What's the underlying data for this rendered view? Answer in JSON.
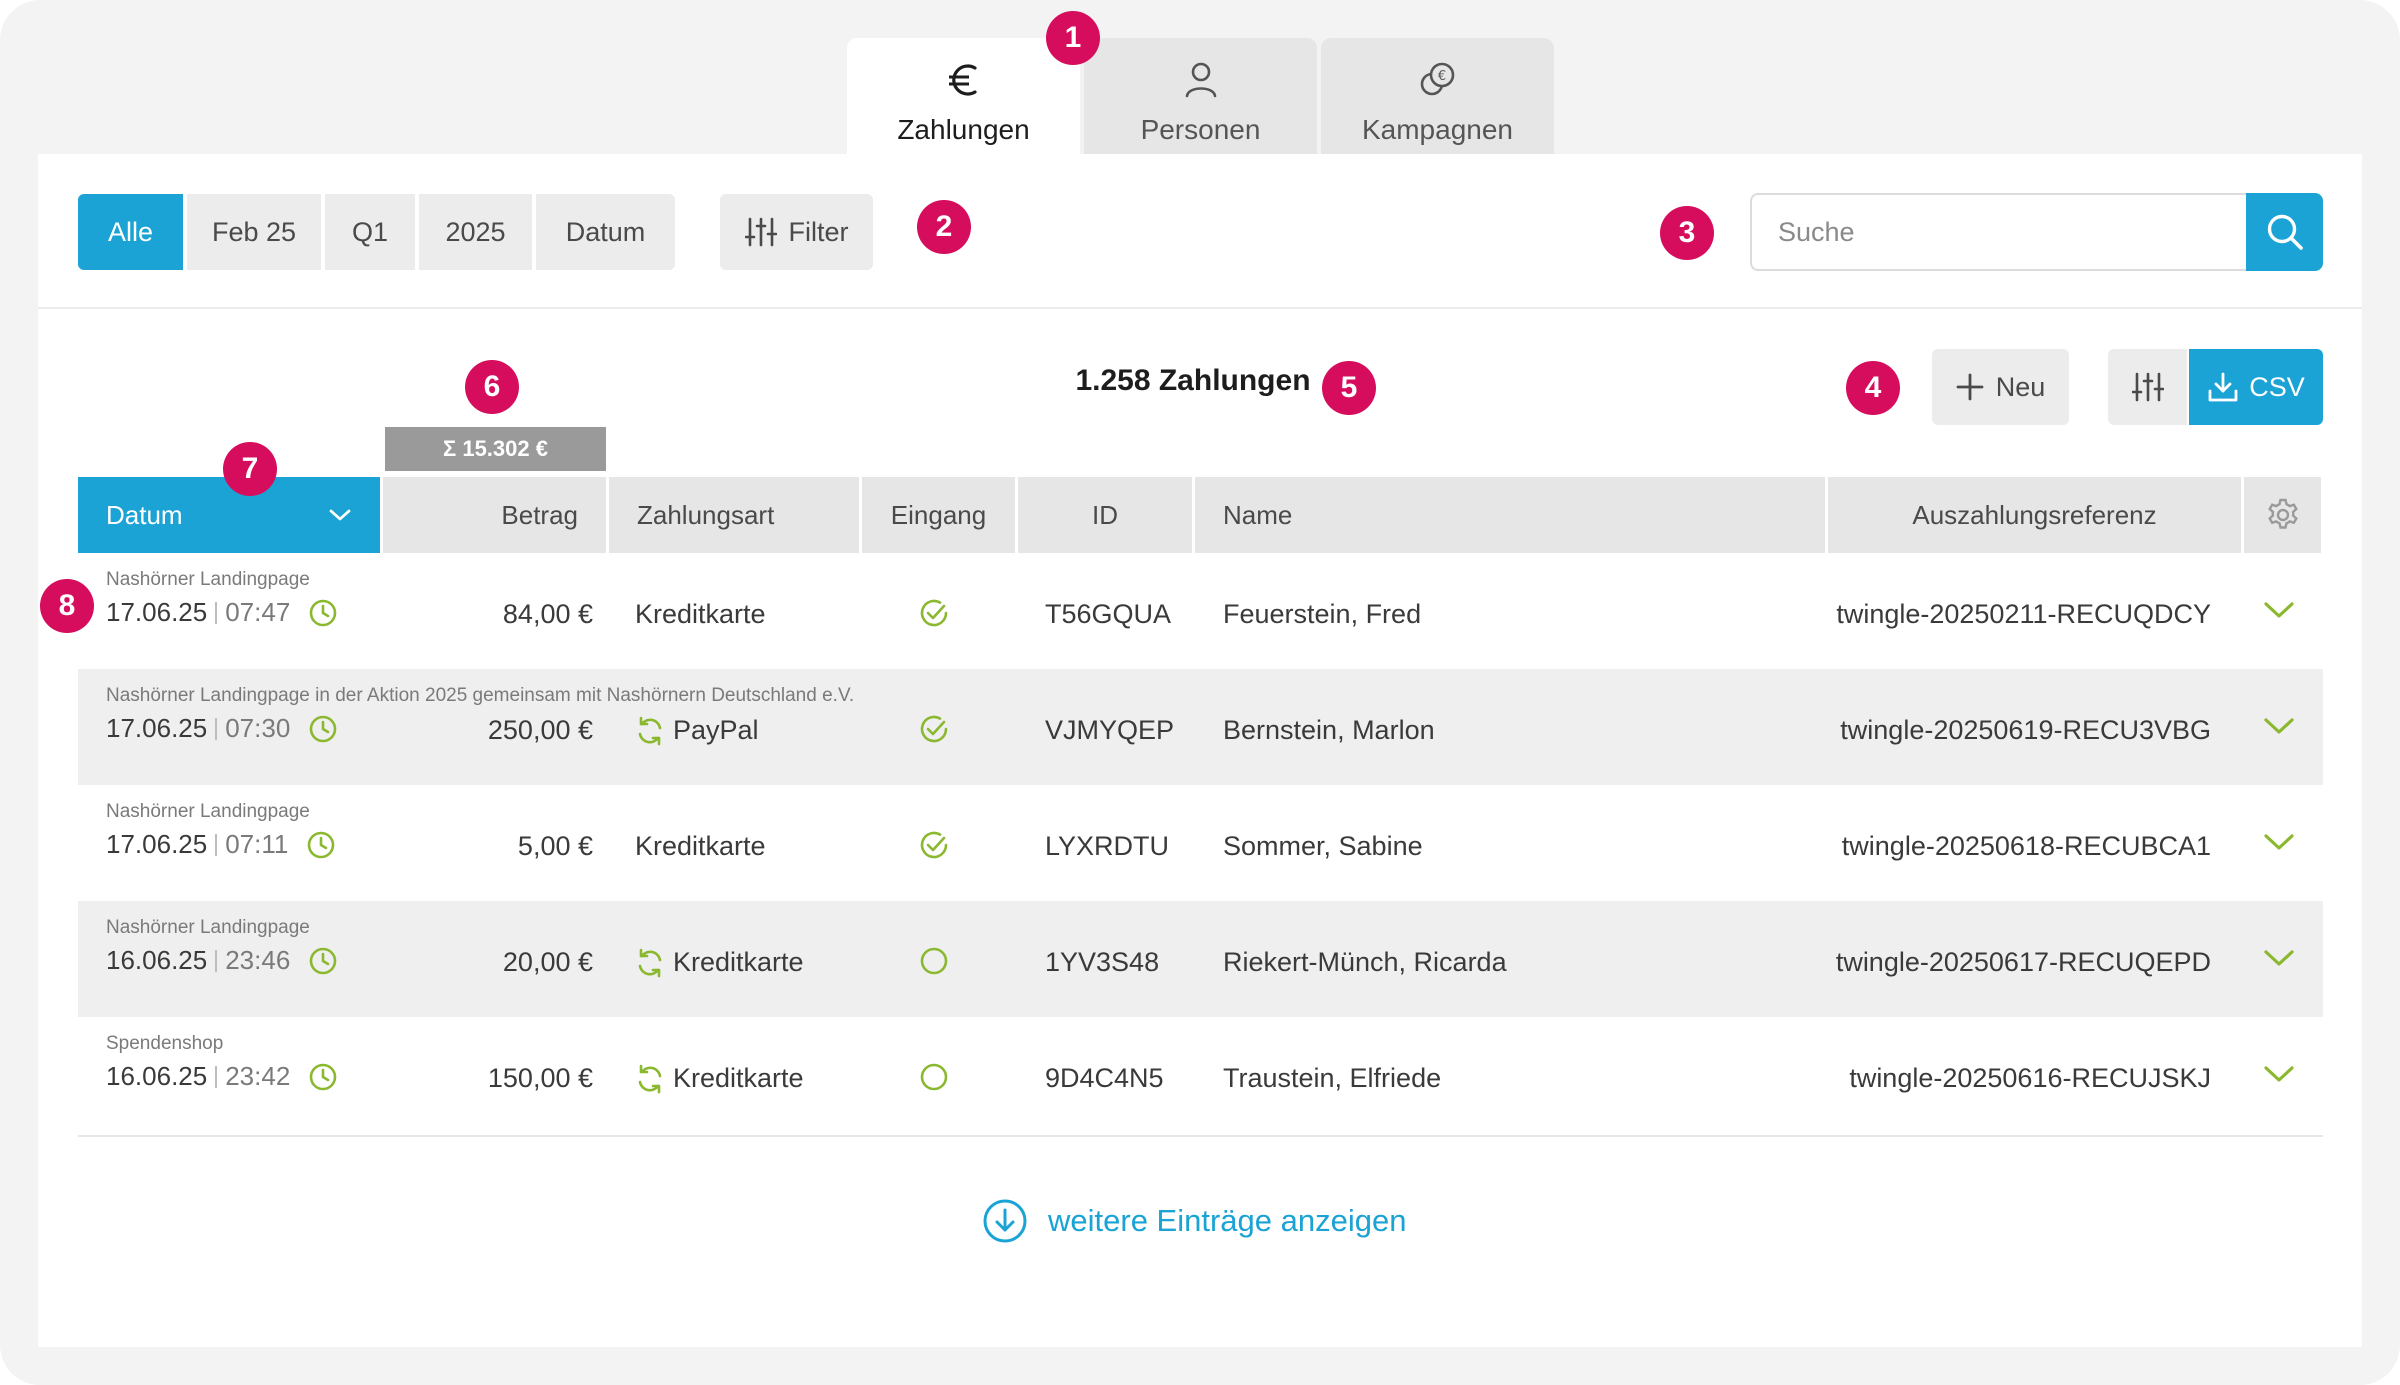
{
  "tabs": [
    {
      "label": "Zahlungen",
      "icon": "euro-icon",
      "active": true
    },
    {
      "label": "Personen",
      "icon": "person-icon",
      "active": false
    },
    {
      "label": "Kampagnen",
      "icon": "campaign-coins-icon",
      "active": false
    }
  ],
  "badges": [
    "1",
    "2",
    "3",
    "4",
    "5",
    "6",
    "7",
    "8"
  ],
  "periods": [
    {
      "label": "Alle",
      "active": true
    },
    {
      "label": "Feb 25",
      "active": false
    },
    {
      "label": "Q1",
      "active": false
    },
    {
      "label": "2025",
      "active": false
    },
    {
      "label": "Datum",
      "active": false
    }
  ],
  "filter": {
    "label": "Filter",
    "icon": "sliders-icon"
  },
  "search": {
    "placeholder": "Suche",
    "value": "",
    "icon": "search-icon"
  },
  "summary": {
    "count": "1.258 Zahlungen",
    "sum": "Σ 15.302 €"
  },
  "actions": {
    "new_label": "Neu",
    "csv_label": "CSV"
  },
  "table": {
    "columns": [
      "Datum",
      "Betrag",
      "Zahlungsart",
      "Eingang",
      "ID",
      "Name",
      "Auszahlungsreferenz"
    ],
    "rows": [
      {
        "source": "Nashörner Landingpage",
        "date": "17.06.25",
        "time": "07:47",
        "amount": "84,00 €",
        "method": "Kreditkarte",
        "recurring": false,
        "received": true,
        "id": "T56GQUA",
        "name": "Feuerstein, Fred",
        "ref": "twingle-20250211-RECUQDCY"
      },
      {
        "source": "Nashörner Landingpage in der Aktion 2025 gemeinsam mit Nashörnern Deutschland e.V.",
        "date": "17.06.25",
        "time": "07:30",
        "amount": "250,00 €",
        "method": "PayPal",
        "recurring": true,
        "received": true,
        "id": "VJMYQEP",
        "name": "Bernstein, Marlon",
        "ref": "twingle-20250619-RECU3VBG"
      },
      {
        "source": "Nashörner Landingpage",
        "date": "17.06.25",
        "time": "07:11",
        "amount": "5,00 €",
        "method": "Kreditkarte",
        "recurring": false,
        "received": true,
        "id": "LYXRDTU",
        "name": "Sommer, Sabine",
        "ref": "twingle-20250618-RECUBCA1"
      },
      {
        "source": "Nashörner Landingpage",
        "date": "16.06.25",
        "time": "23:46",
        "amount": "20,00 €",
        "method": "Kreditkarte",
        "recurring": true,
        "received": false,
        "id": "1YV3S48",
        "name": "Riekert-Münch, Ricarda",
        "ref": "twingle-20250617-RECUQEPD"
      },
      {
        "source": "Spendenshop",
        "date": "16.06.25",
        "time": "23:42",
        "amount": "150,00 €",
        "method": "Kreditkarte",
        "recurring": true,
        "received": false,
        "id": "9D4C4N5",
        "name": "Traustein, Elfriede",
        "ref": "twingle-20250616-RECUJSKJ"
      }
    ]
  },
  "more_label": "weitere Einträge anzeigen",
  "colors": {
    "accent": "#1aa3d4",
    "badge": "#d60d5d",
    "success": "#8ab82f"
  }
}
